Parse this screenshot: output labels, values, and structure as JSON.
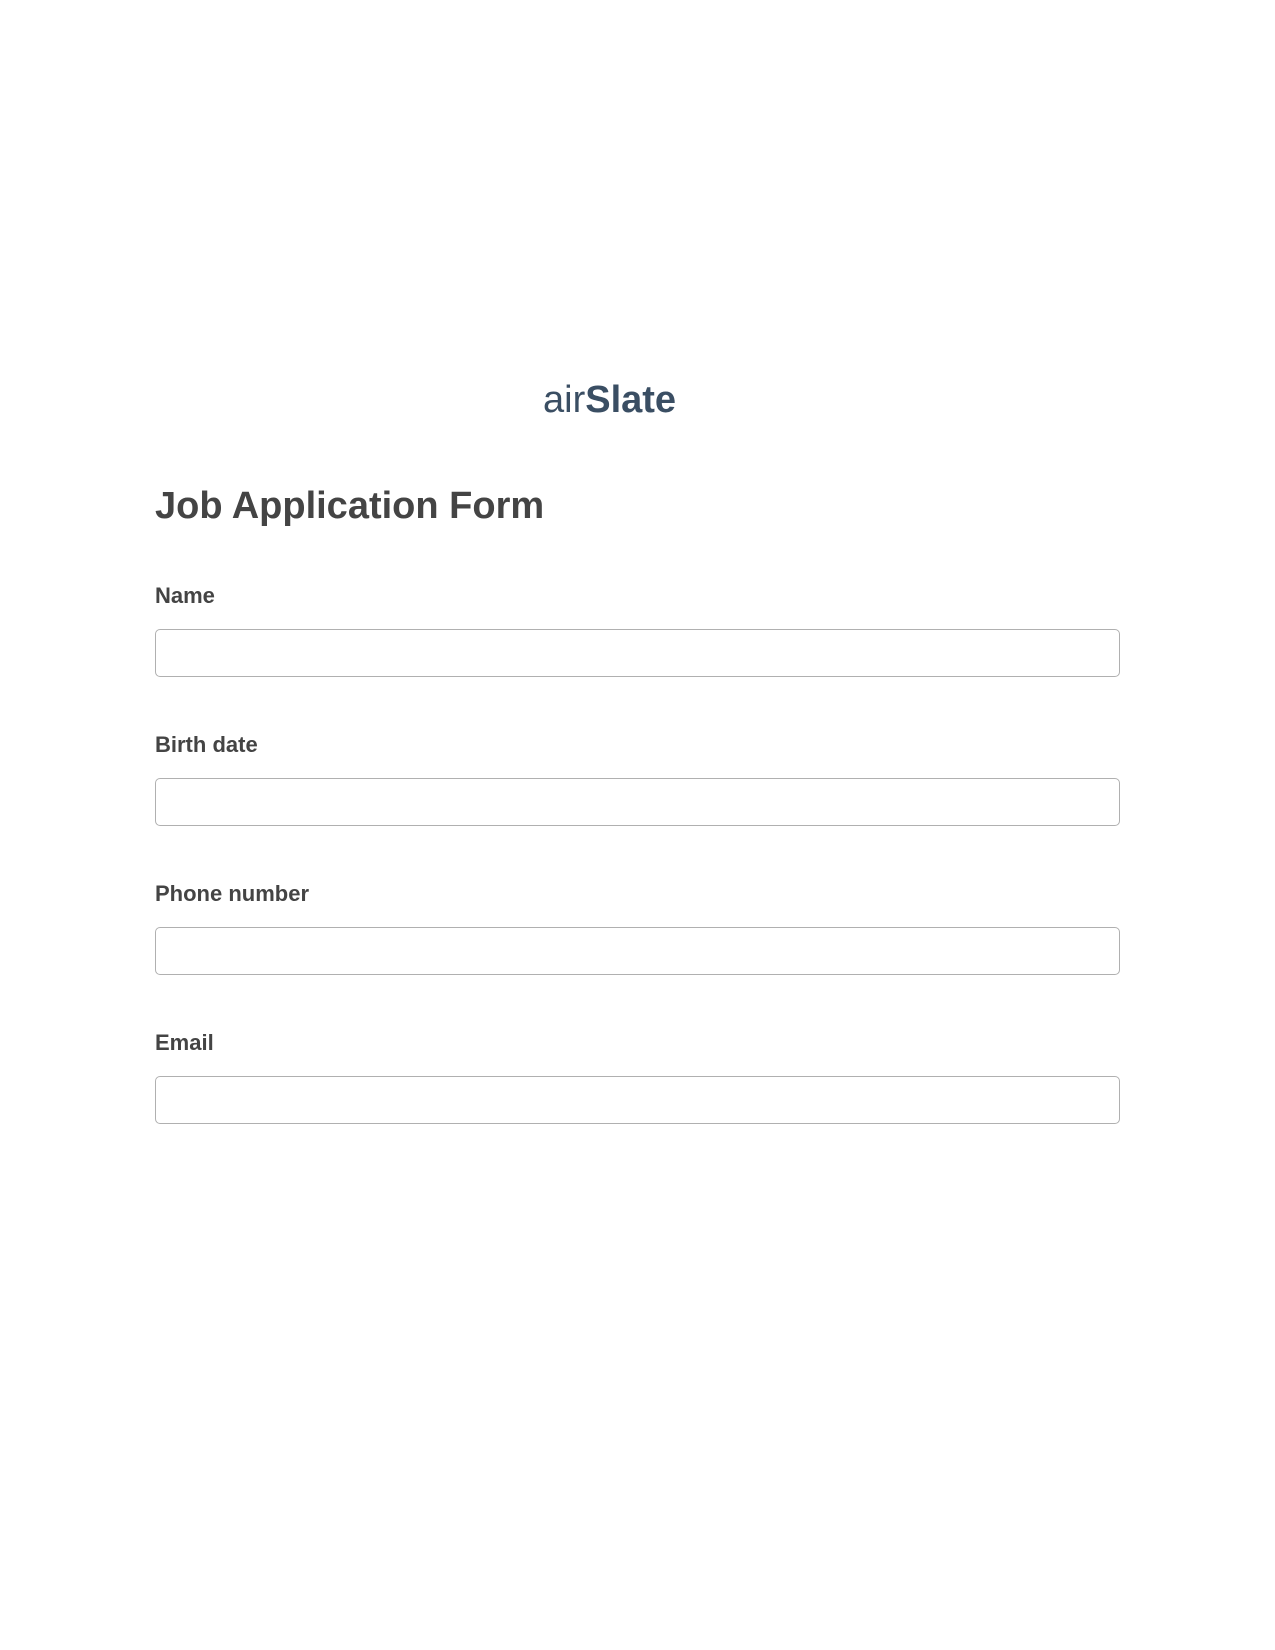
{
  "brand": {
    "logo_text": "airSlate",
    "color": "#3a4e63"
  },
  "form": {
    "title": "Job Application Form",
    "fields": [
      {
        "label": "Name",
        "value": ""
      },
      {
        "label": "Birth date",
        "value": ""
      },
      {
        "label": "Phone number",
        "value": ""
      },
      {
        "label": "Email",
        "value": ""
      }
    ]
  }
}
